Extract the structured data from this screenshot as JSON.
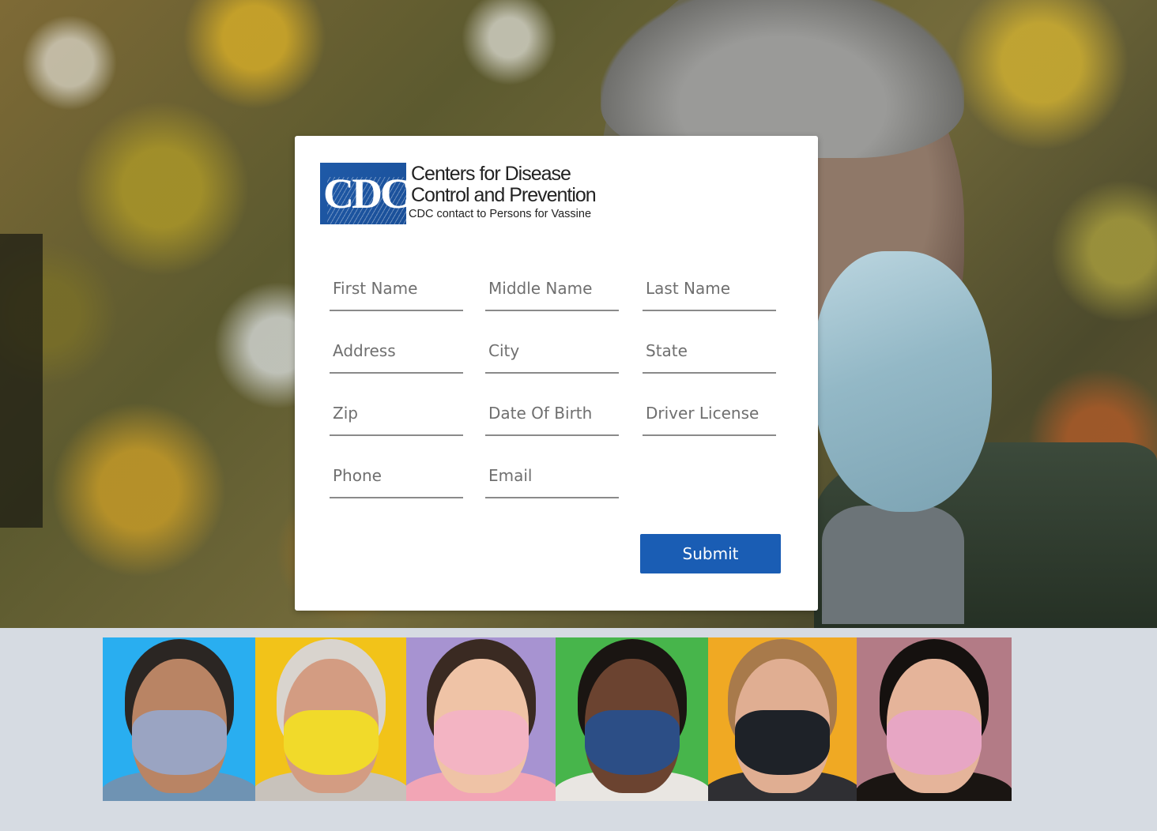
{
  "logo": {
    "abbr": "CDC",
    "line1": "Centers for Disease",
    "line2": "Control and Prevention",
    "tagline": "CDC contact to Persons for Vassine"
  },
  "form": {
    "first_name": {
      "placeholder": "First Name",
      "value": ""
    },
    "middle_name": {
      "placeholder": "Middle Name",
      "value": ""
    },
    "last_name": {
      "placeholder": "Last Name",
      "value": ""
    },
    "address": {
      "placeholder": "Address",
      "value": ""
    },
    "city": {
      "placeholder": "City",
      "value": ""
    },
    "state": {
      "placeholder": "State",
      "value": ""
    },
    "zip": {
      "placeholder": "Zip",
      "value": ""
    },
    "dob": {
      "placeholder": "Date Of Birth",
      "value": ""
    },
    "driver_license": {
      "placeholder": "Driver License",
      "value": ""
    },
    "phone": {
      "placeholder": "Phone",
      "value": ""
    },
    "email": {
      "placeholder": "Email",
      "value": ""
    },
    "submit_label": "Submit"
  },
  "colors": {
    "accent": "#1a5db4",
    "page_bg": "#d6dbe2",
    "card_bg": "#ffffff"
  },
  "banner": {
    "tiles": [
      {
        "bg": "#29aef0",
        "mask": "#9aa4c2",
        "hair": "#2b2623",
        "skin": "#b98464",
        "shirt": "#6f93b3"
      },
      {
        "bg": "#f2c319",
        "mask": "#f1da2a",
        "hair": "#d9d4ce",
        "skin": "#d39c82",
        "shirt": "#c8c2bb"
      },
      {
        "bg": "#a793d1",
        "mask": "#f3b4c3",
        "hair": "#3a2a22",
        "skin": "#efc3a6",
        "shirt": "#f2a5b5"
      },
      {
        "bg": "#47b54b",
        "mask": "#2c4e86",
        "hair": "#1a1512",
        "skin": "#6b4330",
        "shirt": "#e9e6e2"
      },
      {
        "bg": "#f0a923",
        "mask": "#1e2228",
        "hair": "#a87a4b",
        "skin": "#e0ae92",
        "shirt": "#2f2f33"
      },
      {
        "bg": "#b37b86",
        "mask": "#e7a6c4",
        "hair": "#15110f",
        "skin": "#e5b49a",
        "shirt": "#1a1512"
      }
    ]
  }
}
